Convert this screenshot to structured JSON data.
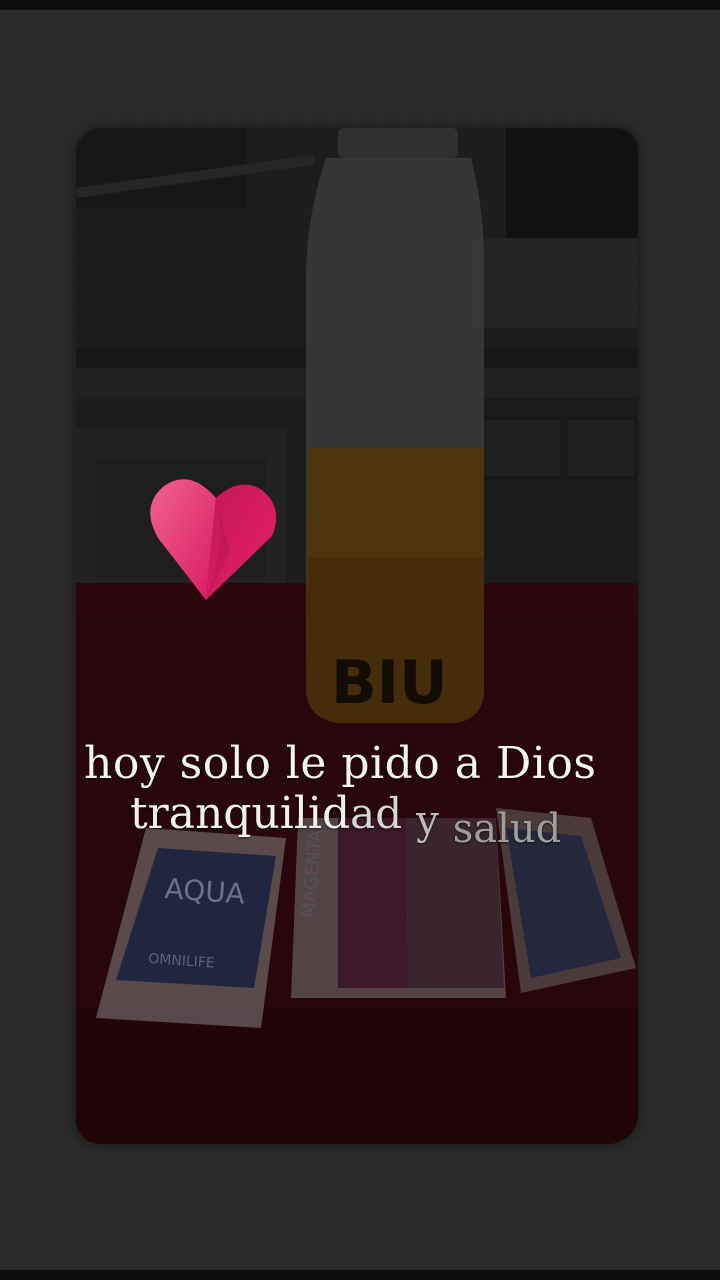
{
  "caption": {
    "line1": "hoy solo le pido a Dios",
    "line2_part1": "tranquilid",
    "line2_part2": "ad",
    "line2_part3": "y",
    "line2_part4": "salud"
  },
  "sticker": {
    "icon": "heart-icon",
    "color": "#e01f6a"
  },
  "photo": {
    "bottle_label": "BIU",
    "sachet_left_label": "AQUA",
    "sachet_left_brand": "OMNILIFE",
    "sachet_center_label": "MAGENTA"
  },
  "colors": {
    "background": "#2b2b2b",
    "tablecloth": "#4a0a14",
    "bottle_juice": "#8a5a10",
    "heart_pink": "#e01f6a"
  }
}
